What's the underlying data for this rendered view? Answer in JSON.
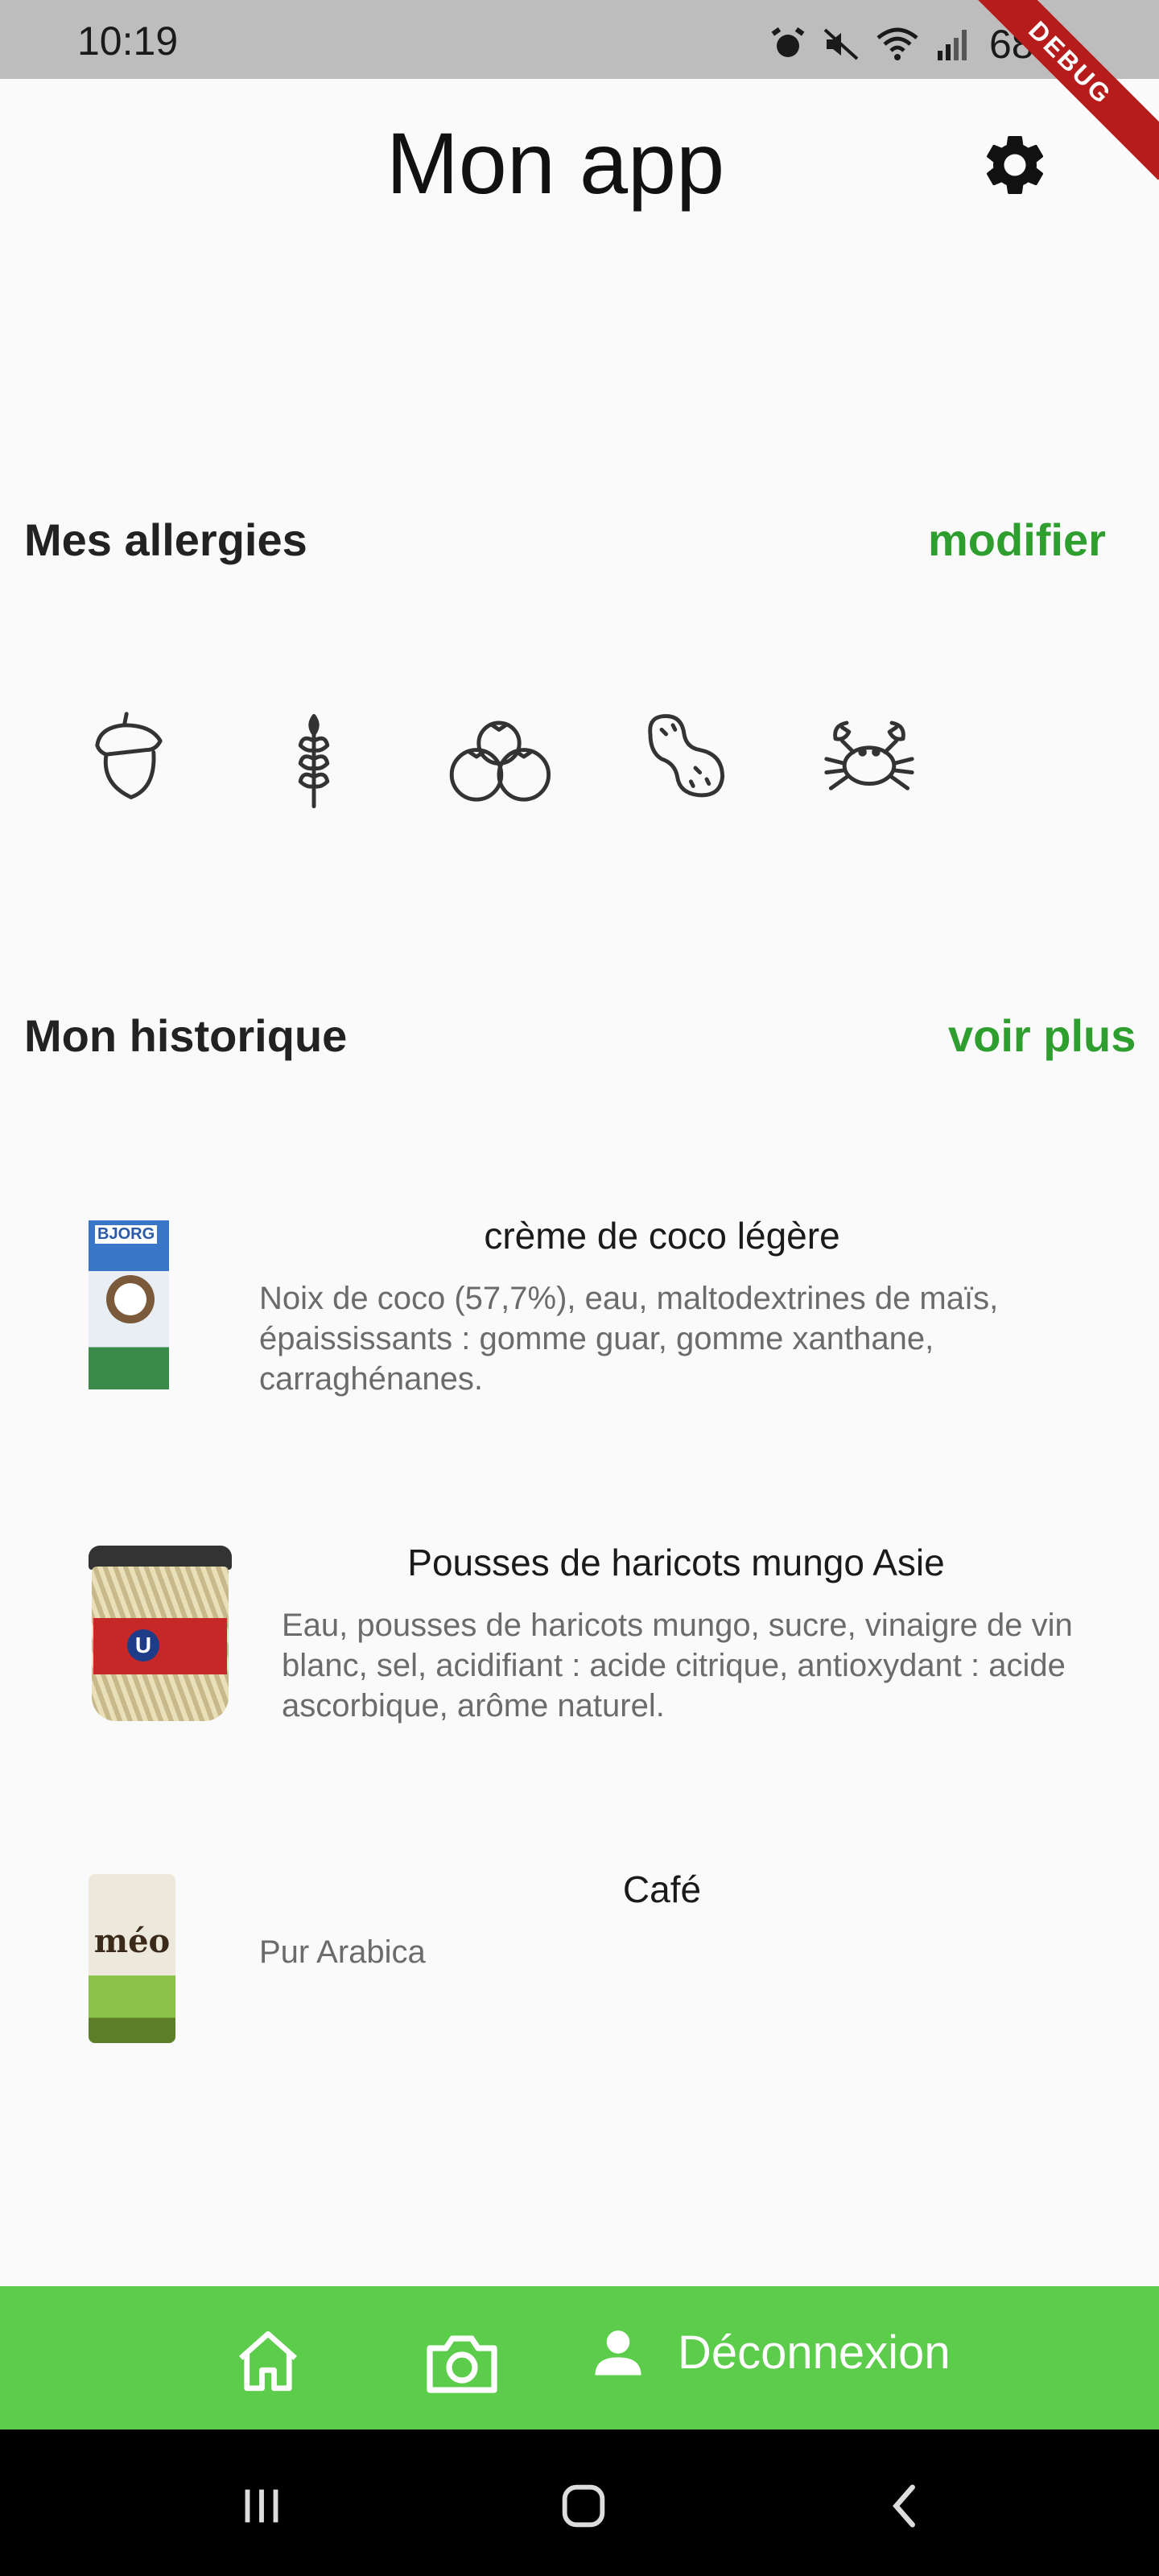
{
  "status_bar": {
    "time": "10:19",
    "battery": "68%"
  },
  "debug_banner": "DEBUG",
  "header": {
    "title": "Mon app"
  },
  "allergies": {
    "title": "Mes allergies",
    "edit_label": "modifier",
    "items": [
      "acorn-icon",
      "wheat-icon",
      "tomato-icon",
      "peanut-icon",
      "crab-icon"
    ]
  },
  "history": {
    "title": "Mon historique",
    "see_more_label": "voir plus",
    "items": [
      {
        "title": "crème de coco légère",
        "description": "Noix de coco (57,7%), eau, maltodextrines de maïs, épaississants : gomme guar, gomme xanthane, carraghénanes.",
        "thumb_text": "BJORG"
      },
      {
        "title": "Pousses de haricots mungo Asie",
        "description": "Eau, pousses de haricots mungo, sucre, vinaigre de vin blanc, sel, acidifiant : acide citrique, antioxydant : acide ascorbique, arôme naturel.",
        "thumb_text": "U"
      },
      {
        "title": "Café",
        "description": "Pur Arabica",
        "thumb_text": "méo"
      }
    ]
  },
  "bottom_nav": {
    "logout_label": "Déconnexion"
  },
  "colors": {
    "accent": "#2e9e2e",
    "nav_bg": "#5ccd4b"
  }
}
